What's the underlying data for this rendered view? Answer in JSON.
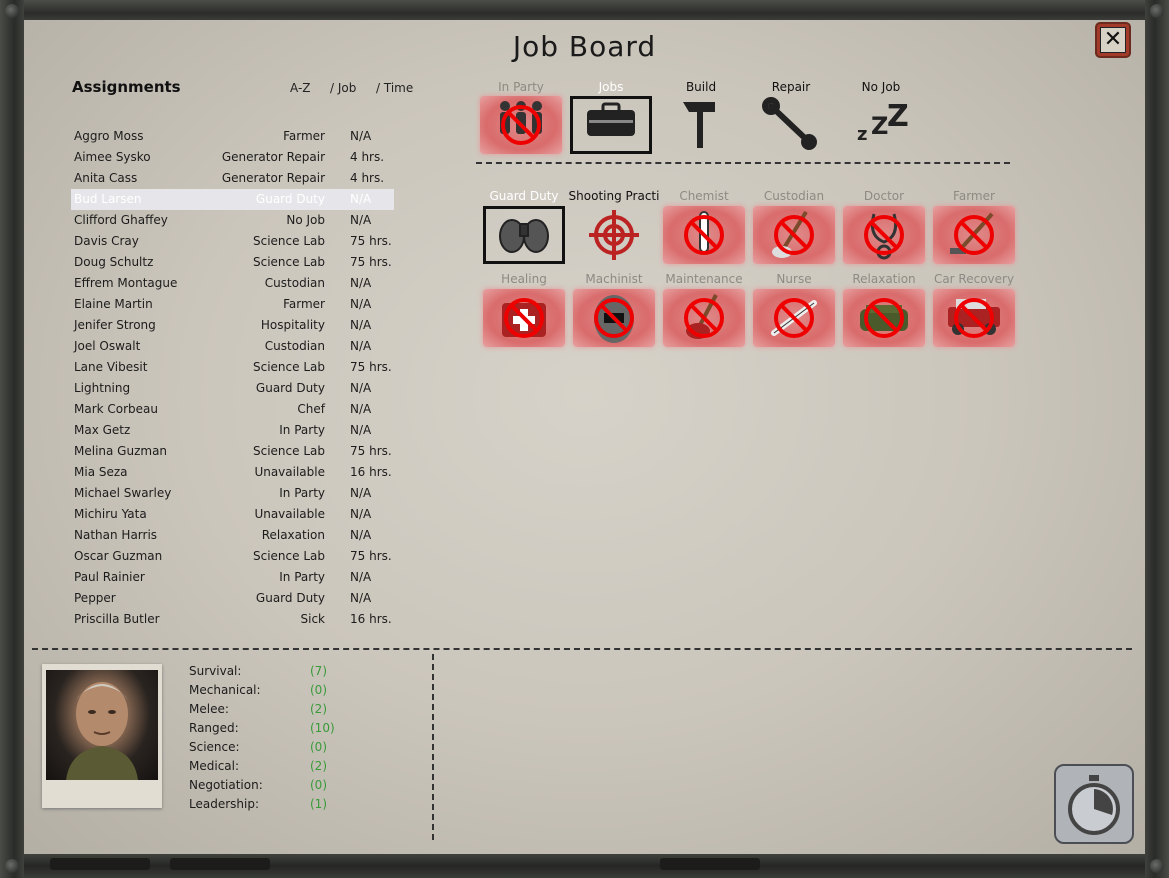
{
  "title": "Job Board",
  "assignments_header": "Assignments",
  "sort": {
    "az": "A-Z",
    "job": "/ Job",
    "time": "/ Time"
  },
  "survivors": [
    {
      "name": "Aggro Moss",
      "job": "Farmer",
      "time": "N/A"
    },
    {
      "name": "Aimee Sysko",
      "job": "Generator Repair",
      "time": "4 hrs."
    },
    {
      "name": "Anita Cass",
      "job": "Generator Repair",
      "time": "4 hrs."
    },
    {
      "name": "Bud Larsen",
      "job": "Guard Duty",
      "time": "N/A"
    },
    {
      "name": "Clifford Ghaffey",
      "job": "No Job",
      "time": "N/A"
    },
    {
      "name": "Davis Cray",
      "job": "Science Lab",
      "time": "75 hrs."
    },
    {
      "name": "Doug Schultz",
      "job": "Science Lab",
      "time": "75 hrs."
    },
    {
      "name": "Effrem Montague",
      "job": "Custodian",
      "time": "N/A"
    },
    {
      "name": "Elaine Martin",
      "job": "Farmer",
      "time": "N/A"
    },
    {
      "name": "Jenifer Strong",
      "job": "Hospitality",
      "time": "N/A"
    },
    {
      "name": "Joel Oswalt",
      "job": "Custodian",
      "time": "N/A"
    },
    {
      "name": "Lane Vibesit",
      "job": "Science Lab",
      "time": "75 hrs."
    },
    {
      "name": "Lightning",
      "job": "Guard Duty",
      "time": "N/A"
    },
    {
      "name": "Mark Corbeau",
      "job": "Chef",
      "time": "N/A"
    },
    {
      "name": "Max Getz",
      "job": "In Party",
      "time": "N/A"
    },
    {
      "name": "Melina Guzman",
      "job": "Science Lab",
      "time": "75 hrs."
    },
    {
      "name": "Mia Seza",
      "job": "Unavailable",
      "time": "16 hrs."
    },
    {
      "name": "Michael Swarley",
      "job": "In Party",
      "time": "N/A"
    },
    {
      "name": "Michiru Yata",
      "job": "Unavailable",
      "time": "N/A"
    },
    {
      "name": "Nathan Harris",
      "job": "Relaxation",
      "time": "N/A"
    },
    {
      "name": "Oscar Guzman",
      "job": "Science Lab",
      "time": "75 hrs."
    },
    {
      "name": "Paul Rainier",
      "job": "In Party",
      "time": "N/A"
    },
    {
      "name": "Pepper",
      "job": "Guard Duty",
      "time": "N/A"
    },
    {
      "name": "Priscilla Butler",
      "job": "Sick",
      "time": "16 hrs."
    }
  ],
  "selected_index": 3,
  "categories": [
    {
      "label": "In Party",
      "state": "locked",
      "icon": "people-icon"
    },
    {
      "label": "Jobs",
      "state": "selected",
      "icon": "briefcase-icon"
    },
    {
      "label": "Build",
      "state": "normal",
      "icon": "hammer-icon"
    },
    {
      "label": "Repair",
      "state": "normal",
      "icon": "wrench-icon"
    },
    {
      "label": "No Job",
      "state": "normal",
      "icon": "sleep-icon"
    }
  ],
  "jobs_row1": [
    {
      "label": "Guard Duty",
      "state": "selected",
      "icon": "binoculars-icon"
    },
    {
      "label": "Shooting Practi",
      "state": "normal",
      "icon": "crosshair-icon"
    },
    {
      "label": "Chemist",
      "state": "locked",
      "icon": "test-tube-icon"
    },
    {
      "label": "Custodian",
      "state": "locked",
      "icon": "mop-icon"
    },
    {
      "label": "Doctor",
      "state": "locked",
      "icon": "stethoscope-icon"
    },
    {
      "label": "Farmer",
      "state": "locked",
      "icon": "hoe-icon"
    }
  ],
  "jobs_row2": [
    {
      "label": "Healing",
      "state": "locked",
      "icon": "medkit-icon"
    },
    {
      "label": "Machinist",
      "state": "locked",
      "icon": "welding-mask-icon"
    },
    {
      "label": "Maintenance",
      "state": "locked",
      "icon": "plunger-icon"
    },
    {
      "label": "Nurse",
      "state": "locked",
      "icon": "thermometer-icon"
    },
    {
      "label": "Relaxation",
      "state": "locked",
      "icon": "cot-icon"
    },
    {
      "label": "Car Recovery",
      "state": "locked",
      "icon": "car-icon"
    }
  ],
  "stats": [
    {
      "name": "Survival:",
      "value": "(7)"
    },
    {
      "name": "Mechanical:",
      "value": "(0)"
    },
    {
      "name": "Melee:",
      "value": "(2)"
    },
    {
      "name": "Ranged:",
      "value": "(10)"
    },
    {
      "name": "Science:",
      "value": "(0)"
    },
    {
      "name": "Medical:",
      "value": "(2)"
    },
    {
      "name": "Negotiation:",
      "value": "(0)"
    },
    {
      "name": "Leadership:",
      "value": "(1)"
    }
  ],
  "colors": {
    "locked": "#d96b6b",
    "selected_border": "#f1e432",
    "stat_value": "#3a9a3a"
  }
}
